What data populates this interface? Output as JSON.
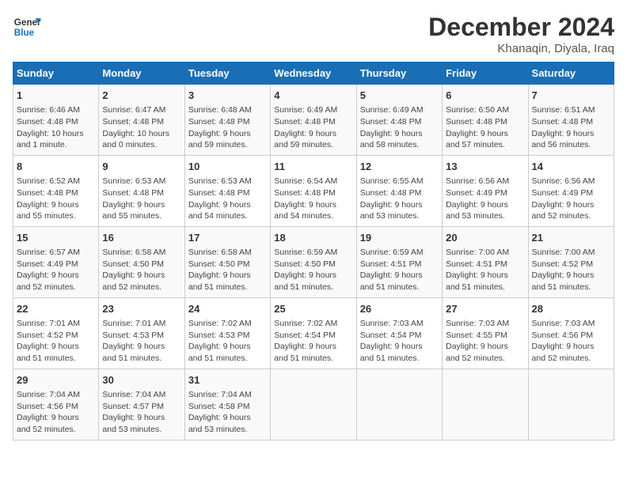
{
  "header": {
    "logo_line1": "General",
    "logo_line2": "Blue",
    "title": "December 2024",
    "subtitle": "Khanaqin, Diyala, Iraq"
  },
  "columns": [
    "Sunday",
    "Monday",
    "Tuesday",
    "Wednesday",
    "Thursday",
    "Friday",
    "Saturday"
  ],
  "weeks": [
    [
      {
        "day": "1",
        "info": "Sunrise: 6:46 AM\nSunset: 4:48 PM\nDaylight: 10 hours\nand 1 minute."
      },
      {
        "day": "2",
        "info": "Sunrise: 6:47 AM\nSunset: 4:48 PM\nDaylight: 10 hours\nand 0 minutes."
      },
      {
        "day": "3",
        "info": "Sunrise: 6:48 AM\nSunset: 4:48 PM\nDaylight: 9 hours\nand 59 minutes."
      },
      {
        "day": "4",
        "info": "Sunrise: 6:49 AM\nSunset: 4:48 PM\nDaylight: 9 hours\nand 59 minutes."
      },
      {
        "day": "5",
        "info": "Sunrise: 6:49 AM\nSunset: 4:48 PM\nDaylight: 9 hours\nand 58 minutes."
      },
      {
        "day": "6",
        "info": "Sunrise: 6:50 AM\nSunset: 4:48 PM\nDaylight: 9 hours\nand 57 minutes."
      },
      {
        "day": "7",
        "info": "Sunrise: 6:51 AM\nSunset: 4:48 PM\nDaylight: 9 hours\nand 56 minutes."
      }
    ],
    [
      {
        "day": "8",
        "info": "Sunrise: 6:52 AM\nSunset: 4:48 PM\nDaylight: 9 hours\nand 55 minutes."
      },
      {
        "day": "9",
        "info": "Sunrise: 6:53 AM\nSunset: 4:48 PM\nDaylight: 9 hours\nand 55 minutes."
      },
      {
        "day": "10",
        "info": "Sunrise: 6:53 AM\nSunset: 4:48 PM\nDaylight: 9 hours\nand 54 minutes."
      },
      {
        "day": "11",
        "info": "Sunrise: 6:54 AM\nSunset: 4:48 PM\nDaylight: 9 hours\nand 54 minutes."
      },
      {
        "day": "12",
        "info": "Sunrise: 6:55 AM\nSunset: 4:48 PM\nDaylight: 9 hours\nand 53 minutes."
      },
      {
        "day": "13",
        "info": "Sunrise: 6:56 AM\nSunset: 4:49 PM\nDaylight: 9 hours\nand 53 minutes."
      },
      {
        "day": "14",
        "info": "Sunrise: 6:56 AM\nSunset: 4:49 PM\nDaylight: 9 hours\nand 52 minutes."
      }
    ],
    [
      {
        "day": "15",
        "info": "Sunrise: 6:57 AM\nSunset: 4:49 PM\nDaylight: 9 hours\nand 52 minutes."
      },
      {
        "day": "16",
        "info": "Sunrise: 6:58 AM\nSunset: 4:50 PM\nDaylight: 9 hours\nand 52 minutes."
      },
      {
        "day": "17",
        "info": "Sunrise: 6:58 AM\nSunset: 4:50 PM\nDaylight: 9 hours\nand 51 minutes."
      },
      {
        "day": "18",
        "info": "Sunrise: 6:59 AM\nSunset: 4:50 PM\nDaylight: 9 hours\nand 51 minutes."
      },
      {
        "day": "19",
        "info": "Sunrise: 6:59 AM\nSunset: 4:51 PM\nDaylight: 9 hours\nand 51 minutes."
      },
      {
        "day": "20",
        "info": "Sunrise: 7:00 AM\nSunset: 4:51 PM\nDaylight: 9 hours\nand 51 minutes."
      },
      {
        "day": "21",
        "info": "Sunrise: 7:00 AM\nSunset: 4:52 PM\nDaylight: 9 hours\nand 51 minutes."
      }
    ],
    [
      {
        "day": "22",
        "info": "Sunrise: 7:01 AM\nSunset: 4:52 PM\nDaylight: 9 hours\nand 51 minutes."
      },
      {
        "day": "23",
        "info": "Sunrise: 7:01 AM\nSunset: 4:53 PM\nDaylight: 9 hours\nand 51 minutes."
      },
      {
        "day": "24",
        "info": "Sunrise: 7:02 AM\nSunset: 4:53 PM\nDaylight: 9 hours\nand 51 minutes."
      },
      {
        "day": "25",
        "info": "Sunrise: 7:02 AM\nSunset: 4:54 PM\nDaylight: 9 hours\nand 51 minutes."
      },
      {
        "day": "26",
        "info": "Sunrise: 7:03 AM\nSunset: 4:54 PM\nDaylight: 9 hours\nand 51 minutes."
      },
      {
        "day": "27",
        "info": "Sunrise: 7:03 AM\nSunset: 4:55 PM\nDaylight: 9 hours\nand 52 minutes."
      },
      {
        "day": "28",
        "info": "Sunrise: 7:03 AM\nSunset: 4:56 PM\nDaylight: 9 hours\nand 52 minutes."
      }
    ],
    [
      {
        "day": "29",
        "info": "Sunrise: 7:04 AM\nSunset: 4:56 PM\nDaylight: 9 hours\nand 52 minutes."
      },
      {
        "day": "30",
        "info": "Sunrise: 7:04 AM\nSunset: 4:57 PM\nDaylight: 9 hours\nand 53 minutes."
      },
      {
        "day": "31",
        "info": "Sunrise: 7:04 AM\nSunset: 4:58 PM\nDaylight: 9 hours\nand 53 minutes."
      },
      {
        "day": "",
        "info": ""
      },
      {
        "day": "",
        "info": ""
      },
      {
        "day": "",
        "info": ""
      },
      {
        "day": "",
        "info": ""
      }
    ]
  ]
}
